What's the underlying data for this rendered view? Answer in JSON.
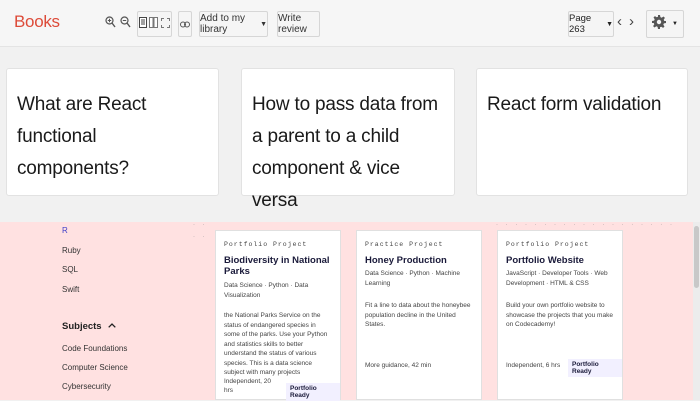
{
  "toolbar": {
    "brand": "Books",
    "add_library_label": "Add to my library",
    "write_review_label": "Write review",
    "page_label": "Page 263",
    "prev_arrow": "‹",
    "next_arrow": "›"
  },
  "questions": [
    {
      "title": "What are React functional components?"
    },
    {
      "title": "How to pass data from a parent to a child component & vice versa"
    },
    {
      "title": "React form validation"
    }
  ],
  "sidebar": {
    "languages": [
      "R",
      "Ruby",
      "SQL",
      "Swift"
    ],
    "subjects_heading": "Subjects",
    "subjects": [
      "Code Foundations",
      "Computer Science",
      "Cybersecurity"
    ]
  },
  "projects": [
    {
      "tag": "Portfolio Project",
      "name": "Biodiversity in National Parks",
      "topics": "Data Science · Python · Data Visualization",
      "description": "the National Parks Service on the status of endangered species in some of the parks. Use your Python and statistics skills to better understand the status of various species. This is a data science subject with many projects",
      "meta": "Independent, 20 hrs",
      "badge": "Portfolio Ready"
    },
    {
      "tag": "Practice Project",
      "name": "Honey Production",
      "topics": "Data Science · Python · Machine Learning",
      "description": "Fit a line to data about the honeybee population decline in the United States.",
      "meta": "More guidance, 42 min",
      "badge": ""
    },
    {
      "tag": "Portfolio Project",
      "name": "Portfolio Website",
      "topics": "JavaScript · Developer Tools · Web Development · HTML & CSS",
      "description": "Build your own portfolio website to showcase the projects that you make on Codecademy!",
      "meta": "Independent, 6 hrs",
      "badge": "Portfolio Ready"
    }
  ]
}
